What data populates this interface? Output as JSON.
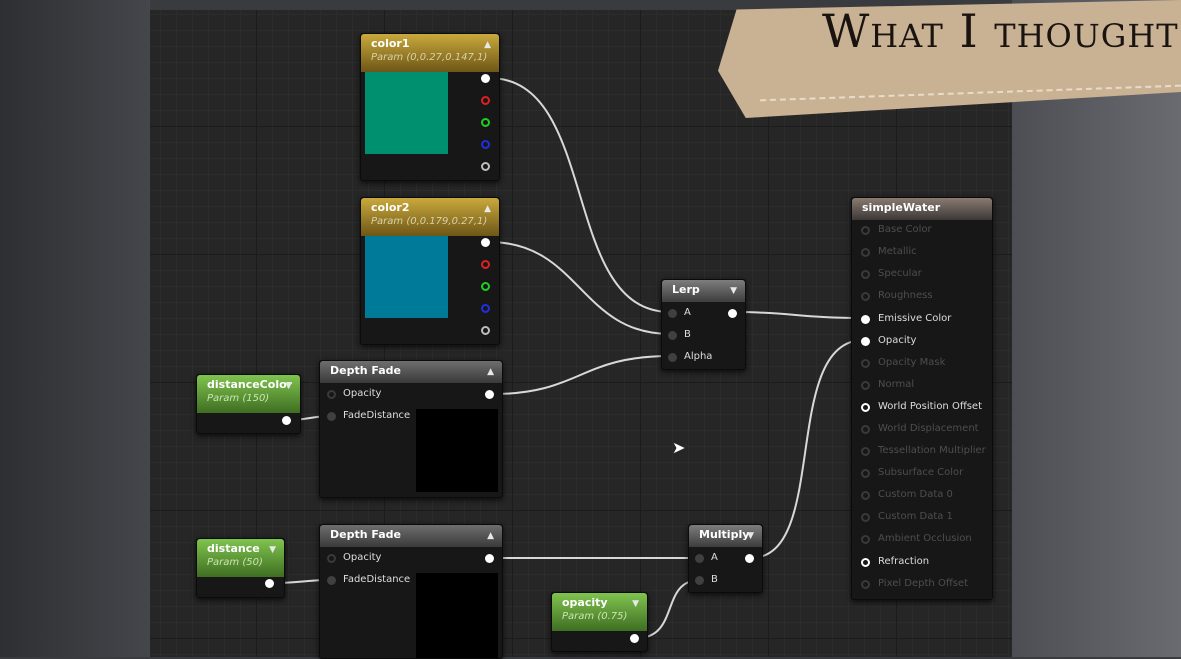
{
  "banner": {
    "text": "What I thought"
  },
  "nodes": {
    "color1": {
      "title": "color1",
      "subtitle": "Param (0,0.27,0.147,1)",
      "swatch": "#009070"
    },
    "color2": {
      "title": "color2",
      "subtitle": "Param (0,0.179,0.27,1)",
      "swatch": "#007a99"
    },
    "distance_color": {
      "title": "distanceColor",
      "subtitle": "Param (150)"
    },
    "depth_fade_1": {
      "title": "Depth Fade",
      "inputs": [
        "Opacity",
        "FadeDistance"
      ]
    },
    "depth_fade_2": {
      "title": "Depth Fade",
      "inputs": [
        "Opacity",
        "FadeDistance"
      ]
    },
    "distance": {
      "title": "distance",
      "subtitle": "Param (50)"
    },
    "opacity": {
      "title": "opacity",
      "subtitle": "Param (0.75)"
    },
    "lerp": {
      "title": "Lerp",
      "inputs": [
        "A",
        "B",
        "Alpha"
      ]
    },
    "multiply": {
      "title": "Multiply",
      "inputs": [
        "A",
        "B"
      ]
    },
    "material": {
      "title": "simpleWater",
      "inputs": [
        "Base Color",
        "Metallic",
        "Specular",
        "Roughness",
        "Emissive Color",
        "Opacity",
        "Opacity Mask",
        "Normal",
        "World Position Offset",
        "World Displacement",
        "Tessellation Multiplier",
        "Subsurface Color",
        "Custom Data 0",
        "Custom Data 1",
        "Ambient Occlusion",
        "Refraction",
        "Pixel Depth Offset"
      ]
    }
  },
  "colors": {
    "param_header": "#c9a93d",
    "scalar_header": "#80c44f",
    "wire": "#d8d8d8"
  }
}
